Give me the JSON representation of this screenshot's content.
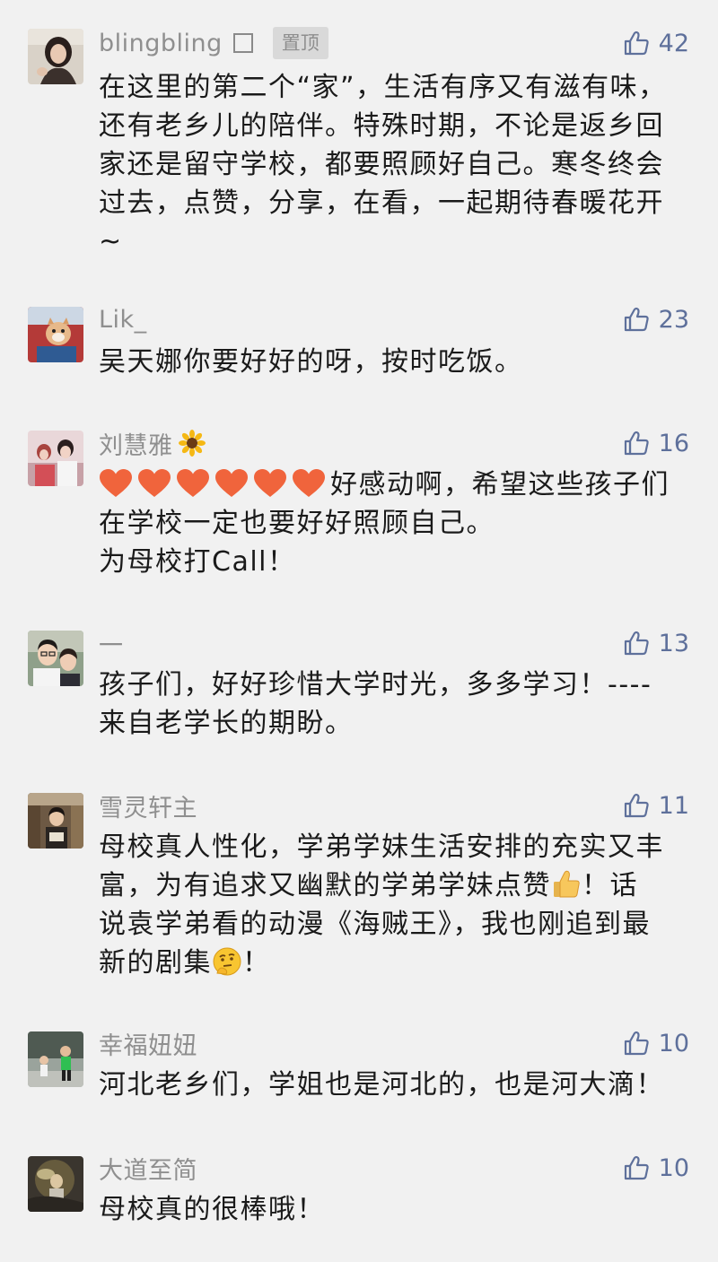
{
  "comments": [
    {
      "nickname": "blingbling",
      "pin_label": "置顶",
      "likes": "42",
      "lines": [
        "在这里的第二个“家”，生活有序又有滋有味，",
        "还有老乡儿的陪伴。特殊时期，不论是返乡回",
        "家还是留守学校，都要照顾好自己。寒冬终会",
        "过去，点赞，分享，在看，一起期待春暖花开",
        "~"
      ]
    },
    {
      "nickname": "Lik_",
      "likes": "23",
      "lines": [
        "吴天娜你要好好的呀，按时吃饭。"
      ]
    },
    {
      "nickname": "刘慧雅",
      "nickname_emoji": "sunflower-icon",
      "likes": "16",
      "line1_text": "好感动啊，希望这些孩子们",
      "lines": [
        "在学校一定也要好好照顾自己。",
        "为母校打Call！"
      ]
    },
    {
      "nickname": "一",
      "likes": "13",
      "lines": [
        "孩子们，好好珍惜大学时光，多多学习！----",
        "来自老学长的期盼。"
      ]
    },
    {
      "nickname": "雪灵轩主",
      "likes": "11",
      "lines": [
        "母校真人性化，学弟学妹生活安排的充实又丰"
      ],
      "line2_a": "富，为有追求又幽默的学弟学妹点赞",
      "line2_b": "！话",
      "line3": "说袁学弟看的动漫《海贼王》，我也刚追到最",
      "line4_a": "新的剧集",
      "line4_b": "！"
    },
    {
      "nickname": "幸福妞妞",
      "likes": "10",
      "lines": [
        "河北老乡们，学姐也是河北的，也是河大滴！"
      ]
    },
    {
      "nickname": "大道至简",
      "likes": "10",
      "lines": [
        "母校真的很棒哦！"
      ]
    }
  ],
  "colors": {
    "background": "#f1f1f1",
    "nickname": "#8f8f8f",
    "like": "#5e709b",
    "text": "#1a1a1a",
    "heart": "#f0643c"
  },
  "icons": [
    "thumbs-up-icon",
    "heart-icon",
    "sunflower-icon",
    "thumbs-up-emoji-icon",
    "thinking-face-icon"
  ]
}
